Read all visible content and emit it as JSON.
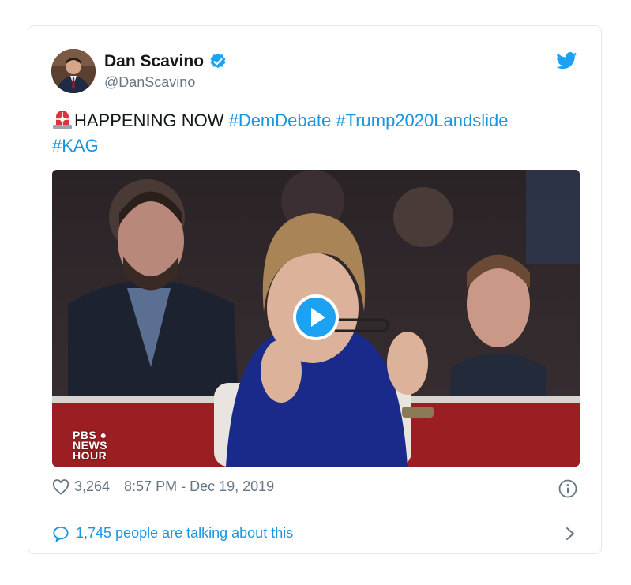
{
  "tweet": {
    "display_name": "Dan Scavino",
    "handle": "@DanScavino",
    "verified": true,
    "text_plain": "HAPPENING NOW ",
    "hashtags": [
      "#DemDebate",
      "#Trump2020Landslide",
      "#KAG"
    ],
    "emoji_icon": "rotating-light-icon",
    "media": {
      "type": "video",
      "watermark_lines": [
        "PBS ●",
        "NEWS",
        "HOUR"
      ]
    },
    "likes": "3,264",
    "timestamp": "8:57 PM - Dec 19, 2019",
    "talking_about": "1,745 people are talking about this"
  },
  "colors": {
    "link": "#1b95e0",
    "secondary_text": "#657786",
    "border": "#e1e8ed",
    "verified": "#1da1f2"
  }
}
